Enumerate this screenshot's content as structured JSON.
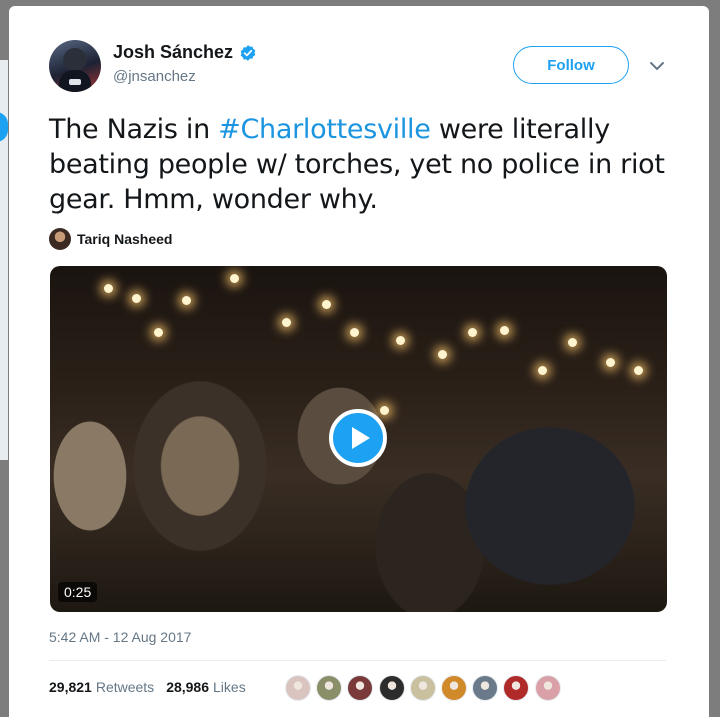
{
  "tweet": {
    "author_name": "Josh Sánchez",
    "verified_icon": "verified-badge-icon",
    "handle": "@jnsanchez",
    "follow_label": "Follow",
    "text_before": "The Nazis in ",
    "hashtag": "#Charlottesville",
    "text_after": " were literally beating people w/ torches, yet no police in riot gear. Hmm, wonder why.",
    "video_credit": "Tariq Nasheed",
    "video_duration": "0:25",
    "timestamp": "5:42 AM - 12 Aug 2017",
    "retweets_count": "29,821",
    "retweets_label": "Retweets",
    "likes_count": "28,986",
    "likes_label": "Likes"
  },
  "colors": {
    "accent": "#1da1f2",
    "hashtag": "#1b95e0",
    "text": "#14171a",
    "muted": "#657786"
  },
  "liker_avatars": [
    {
      "color": "#d9c4c0"
    },
    {
      "color": "#8a8f6a"
    },
    {
      "color": "#7a3a3a"
    },
    {
      "color": "#2c2c2c"
    },
    {
      "color": "#c9c0a0"
    },
    {
      "color": "#d08a2a"
    },
    {
      "color": "#6a7a8a"
    },
    {
      "color": "#b02a2a"
    },
    {
      "color": "#d9a0a8"
    }
  ]
}
